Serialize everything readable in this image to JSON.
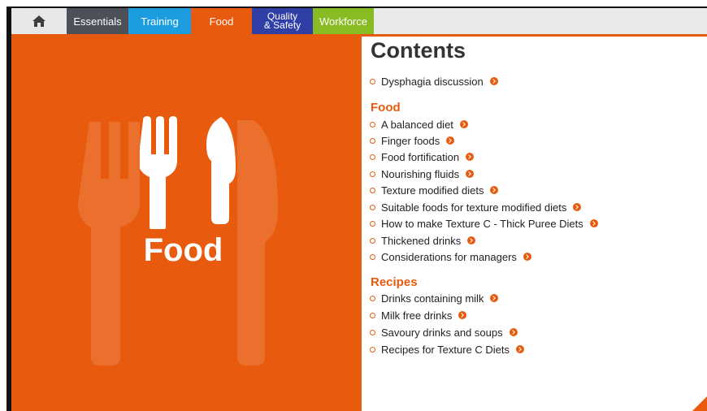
{
  "nav": {
    "tabs": {
      "home": "home-icon",
      "essentials": "Essentials",
      "training": "Training",
      "food": "Food",
      "quality_line1": "Quality",
      "quality_line2": "& Safety",
      "workforce": "Workforce"
    }
  },
  "hero": {
    "label": "Food",
    "icon": "fork-knife-icon"
  },
  "contents": {
    "title": "Contents",
    "intro_items": [
      "Dysphagia discussion"
    ],
    "sections": [
      {
        "heading": "Food",
        "items": [
          "A balanced diet",
          "Finger foods",
          "Food fortification",
          "Nourishing fluids",
          "Texture modified diets",
          "Suitable foods for texture modified diets",
          "How to make Texture C - Thick Puree Diets",
          "Thickened drinks",
          "Considerations for managers"
        ]
      },
      {
        "heading": "Recipes",
        "items": [
          "Drinks containing milk",
          "Milk free drinks",
          "Savoury drinks and soups",
          "Recipes for Texture C Diets"
        ]
      }
    ]
  },
  "colors": {
    "accent": "#e85a0e",
    "essentials": "#4b5059",
    "training": "#1b9de0",
    "quality": "#2f3fa6",
    "workforce": "#88bb24"
  }
}
